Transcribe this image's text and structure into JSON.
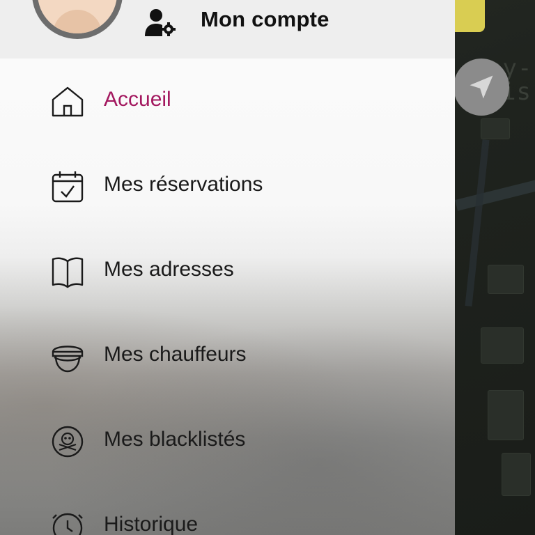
{
  "header": {
    "title": "Mon compte"
  },
  "menu": {
    "items": [
      {
        "label": "Accueil",
        "icon": "home-icon",
        "active": true
      },
      {
        "label": "Mes réservations",
        "icon": "calendar-check-icon",
        "active": false
      },
      {
        "label": "Mes adresses",
        "icon": "book-icon",
        "active": false
      },
      {
        "label": "Mes chauffeurs",
        "icon": "chauffeur-cap-icon",
        "active": false
      },
      {
        "label": "Mes blacklistés",
        "icon": "skull-crossbones-icon",
        "active": false
      },
      {
        "label": "Historique",
        "icon": "clock-icon",
        "active": false
      }
    ]
  },
  "map": {
    "chip_text": "...",
    "label_text": "ay-\nis"
  },
  "colors": {
    "accent": "#a3185f",
    "header_bg": "#eeeeee",
    "chip": "#d9cd52"
  }
}
